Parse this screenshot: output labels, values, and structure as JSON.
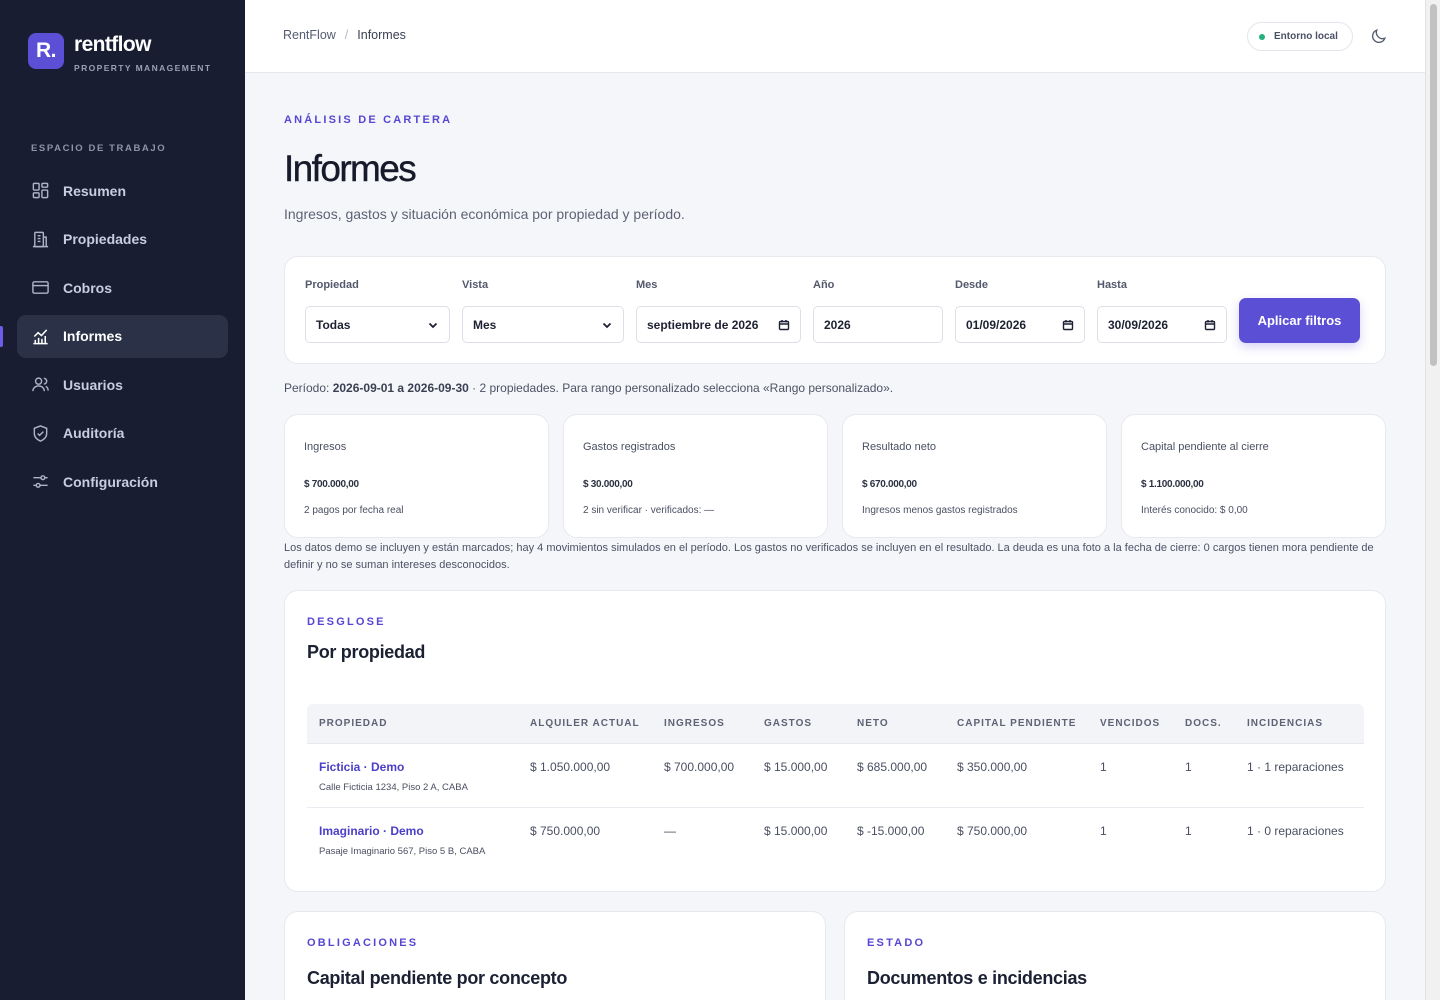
{
  "brand": {
    "mark": "R.",
    "name": "rentflow",
    "tagline": "PROPERTY MANAGEMENT"
  },
  "sidebar": {
    "section_label": "ESPACIO DE TRABAJO",
    "items": [
      {
        "label": "Resumen",
        "icon": "grid-icon",
        "active": false
      },
      {
        "label": "Propiedades",
        "icon": "building-icon",
        "active": false
      },
      {
        "label": "Cobros",
        "icon": "credit-card-icon",
        "active": false
      },
      {
        "label": "Informes",
        "icon": "chart-icon",
        "active": true
      },
      {
        "label": "Usuarios",
        "icon": "users-icon",
        "active": false
      },
      {
        "label": "Auditoría",
        "icon": "shield-icon",
        "active": false
      },
      {
        "label": "Configuración",
        "icon": "sliders-icon",
        "active": false
      }
    ]
  },
  "topbar": {
    "breadcrumb": [
      "RentFlow",
      "Informes"
    ],
    "breadcrumb_separator": "/",
    "environment": "Entorno local",
    "theme_toggle_icon": "moon-icon"
  },
  "page": {
    "eyebrow": "ANÁLISIS DE CARTERA",
    "title": "Informes",
    "subtitle": "Ingresos, gastos y situación económica por propiedad y período."
  },
  "filters": {
    "propiedad": {
      "label": "Propiedad",
      "value": "Todas"
    },
    "vista": {
      "label": "Vista",
      "value": "Mes"
    },
    "mes": {
      "label": "Mes",
      "value": "septiembre de 2026"
    },
    "anio": {
      "label": "Año",
      "value": "2026"
    },
    "desde": {
      "label": "Desde",
      "value": "01/09/2026"
    },
    "hasta": {
      "label": "Hasta",
      "value": "30/09/2026"
    },
    "apply_label": "Aplicar filtros"
  },
  "period": {
    "prefix": "Período: ",
    "range": "2026-09-01 a 2026-09-30",
    "suffix": " · 2 propiedades. Para rango personalizado selecciona «Rango personalizado»."
  },
  "kpis": [
    {
      "label": "Ingresos",
      "value": "$ 700.000,00",
      "note": "2 pagos por fecha real"
    },
    {
      "label": "Gastos registrados",
      "value": "$ 30.000,00",
      "note": "2 sin verificar · verificados: —"
    },
    {
      "label": "Resultado neto",
      "value": "$ 670.000,00",
      "note": "Ingresos menos gastos registrados"
    },
    {
      "label": "Capital pendiente al cierre",
      "value": "$ 1.100.000,00",
      "note": "Interés conocido: $ 0,00"
    }
  ],
  "disclaimer": "Los datos demo se incluyen y están marcados; hay 4 movimientos simulados en el período. Los gastos no verificados se incluyen en el resultado. La deuda es una foto a la fecha de cierre: 0 cargos tienen mora pendiente de definir y no se suman intereses desconocidos.",
  "breakdown": {
    "eyebrow": "DESGLOSE",
    "title": "Por propiedad",
    "columns": [
      "PROPIEDAD",
      "ALQUILER ACTUAL",
      "INGRESOS",
      "GASTOS",
      "NETO",
      "CAPITAL PENDIENTE",
      "VENCIDOS",
      "DOCS.",
      "INCIDENCIAS"
    ],
    "rows": [
      {
        "name": "Ficticia · Demo",
        "address": "Calle Ficticia 1234, Piso 2 A, CABA",
        "rent": "$ 1.050.000,00",
        "income": "$ 700.000,00",
        "expenses": "$ 15.000,00",
        "net": "$ 685.000,00",
        "pending": "$ 350.000,00",
        "overdue": "1",
        "docs": "1",
        "incidents": "1 · 1 reparaciones"
      },
      {
        "name": "Imaginario · Demo",
        "address": "Pasaje Imaginario 567, Piso 5 B, CABA",
        "rent": "$ 750.000,00",
        "income": "—",
        "expenses": "$ 15.000,00",
        "net": "$ -15.000,00",
        "pending": "$ 750.000,00",
        "overdue": "1",
        "docs": "1",
        "incidents": "1 · 0 reparaciones"
      }
    ]
  },
  "obligations": {
    "eyebrow": "OBLIGACIONES",
    "title": "Capital pendiente por concepto"
  },
  "status": {
    "eyebrow": "ESTADO",
    "title": "Documentos e incidencias"
  },
  "colors": {
    "sidebar_bg": "#181d31",
    "accent": "#5b4fd6",
    "status_ok": "#22b07d"
  }
}
